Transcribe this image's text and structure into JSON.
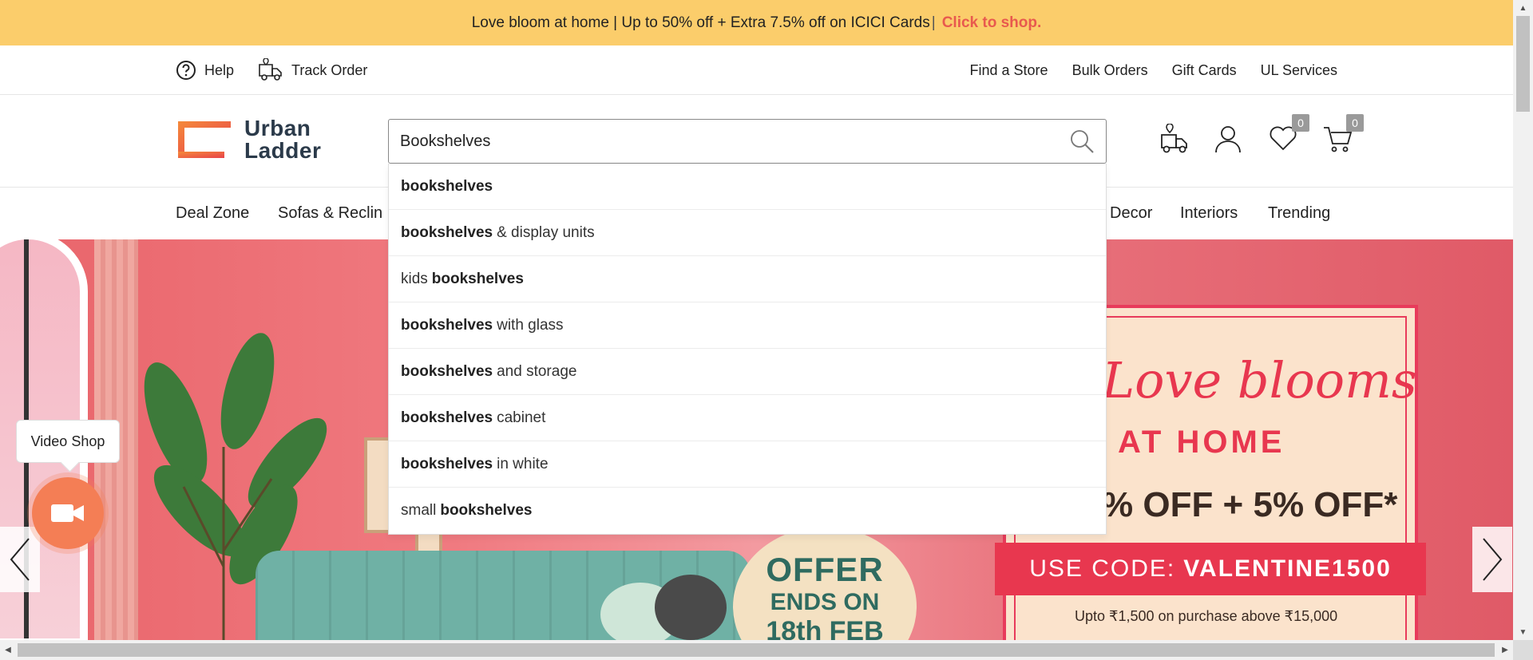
{
  "promo_bar": {
    "text": "Love bloom at home | Up to 50% off + Extra 7.5% off on ICICI Cards",
    "separator": "|",
    "cta": "Click to shop.",
    "background": "#fbcd6b",
    "cta_color": "#e8594e"
  },
  "utility": {
    "help": "Help",
    "track_order": "Track Order",
    "find_store": "Find a Store",
    "bulk_orders": "Bulk Orders",
    "gift_cards": "Gift Cards",
    "ul_services": "UL Services"
  },
  "logo": {
    "line1": "Urban",
    "line2": "Ladder",
    "mark_color": "#f26c2b"
  },
  "search": {
    "value": "Bookshelves",
    "icon": "search-icon"
  },
  "header_icons": {
    "wishlist_count": "0",
    "cart_count": "0"
  },
  "nav": {
    "items": [
      "Deal Zone",
      "Sofas & Reclin",
      "Decor",
      "Interiors",
      "Trending"
    ]
  },
  "suggestions": [
    {
      "pre": "",
      "bold": "bookshelves",
      "post": ""
    },
    {
      "pre": "",
      "bold": "bookshelves",
      "post": "& display units"
    },
    {
      "pre": "kids",
      "bold": "bookshelves",
      "post": ""
    },
    {
      "pre": "",
      "bold": "bookshelves",
      "post": "with glass"
    },
    {
      "pre": "",
      "bold": "bookshelves",
      "post": "and storage"
    },
    {
      "pre": "",
      "bold": "bookshelves",
      "post": "cabinet"
    },
    {
      "pre": "",
      "bold": "bookshelves",
      "post": "in white"
    },
    {
      "pre": "small",
      "bold": "bookshelves",
      "post": ""
    }
  ],
  "hero": {
    "headline": "Love blooms",
    "subhead": "AT HOME",
    "discount": "% OFF + 5% OFF*",
    "code_label": "USE CODE:",
    "code": "VALENTINE1500",
    "fineprint": "Upto ₹1,500 on purchase above ₹15,000",
    "offer_line1": "OFFER",
    "offer_line2": "ENDS ON",
    "offer_line3": "18th FEB",
    "accent": "#e8374f"
  },
  "video_shop": {
    "label": "Video Shop",
    "button_color": "#f47e55"
  }
}
